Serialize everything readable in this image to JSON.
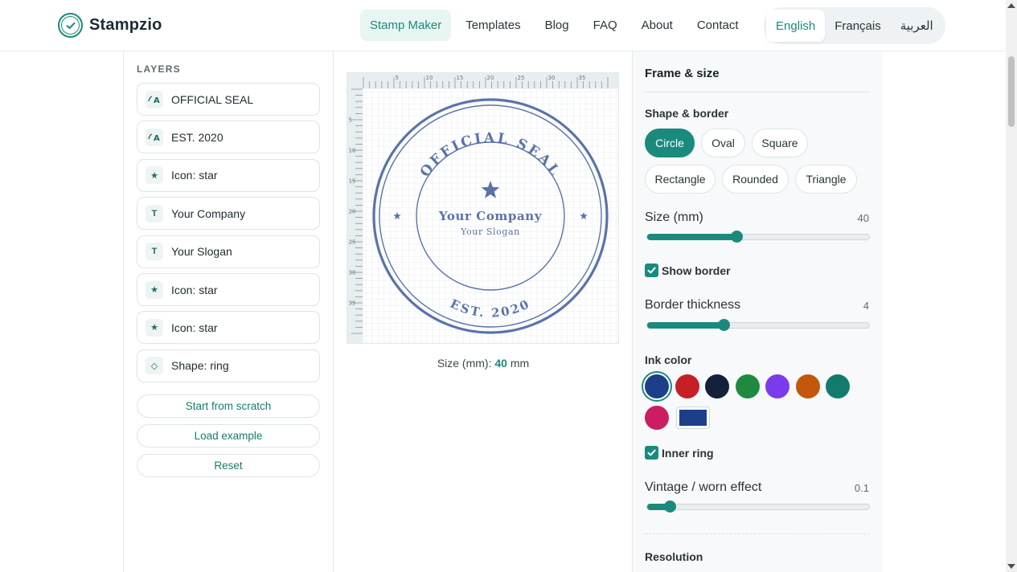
{
  "brand": {
    "name": "Stampzio"
  },
  "nav": {
    "items": [
      {
        "label": "Stamp Maker",
        "active": true
      },
      {
        "label": "Templates",
        "active": false
      },
      {
        "label": "Blog",
        "active": false
      },
      {
        "label": "FAQ",
        "active": false
      },
      {
        "label": "About",
        "active": false
      },
      {
        "label": "Contact",
        "active": false
      }
    ]
  },
  "languages": [
    {
      "label": "English",
      "active": true
    },
    {
      "label": "Français",
      "active": false
    },
    {
      "label": "العربية",
      "active": false
    }
  ],
  "layers": {
    "title": "LAYERS",
    "items": [
      {
        "label": "OFFICIAL SEAL",
        "icon": "curved-text-icon",
        "glyph": "A"
      },
      {
        "label": "EST. 2020",
        "icon": "curved-text-icon",
        "glyph": "A"
      },
      {
        "label": "Icon: star",
        "icon": "star-icon",
        "glyph": "★"
      },
      {
        "label": "Your Company",
        "icon": "text-icon",
        "glyph": "T"
      },
      {
        "label": "Your Slogan",
        "icon": "text-icon",
        "glyph": "T"
      },
      {
        "label": "Icon: star",
        "icon": "star-icon",
        "glyph": "★"
      },
      {
        "label": "Icon: star",
        "icon": "star-icon",
        "glyph": "★"
      },
      {
        "label": "Shape: ring",
        "icon": "ring-shape-icon",
        "glyph": "◇"
      }
    ],
    "actions": {
      "start": "Start from scratch",
      "load": "Load example",
      "reset": "Reset"
    }
  },
  "stamp": {
    "top_text": "OFFICIAL SEAL",
    "bottom_text": "EST. 2020",
    "company": "Your Company",
    "slogan": "Your Slogan",
    "ink_color": "#5a73aa",
    "ruler_labels": [
      "5",
      "10",
      "15",
      "20",
      "25",
      "30",
      "35"
    ]
  },
  "canvas": {
    "size_label": "Size (mm):",
    "size_value": "40",
    "size_unit": "mm"
  },
  "settings": {
    "title": "Frame & size",
    "shape_label": "Shape & border",
    "shapes": [
      {
        "label": "Circle",
        "active": true
      },
      {
        "label": "Oval",
        "active": false
      },
      {
        "label": "Square",
        "active": false
      },
      {
        "label": "Rectangle",
        "active": false
      },
      {
        "label": "Rounded",
        "active": false
      },
      {
        "label": "Triangle",
        "active": false
      }
    ],
    "size": {
      "label": "Size (mm)",
      "value": "40",
      "fraction": 0.4
    },
    "show_border": {
      "label": "Show border",
      "checked": true
    },
    "border_thickness": {
      "label": "Border thickness",
      "value": "4",
      "fraction": 0.34
    },
    "ink": {
      "label": "Ink color",
      "colors": [
        "#1d3f8a",
        "#c42026",
        "#15203a",
        "#1f8a3f",
        "#7c3aed",
        "#c2570c",
        "#137a6e",
        "#cc1d62"
      ],
      "selected": "#1d3f8a",
      "custom": "#1d3f8a"
    },
    "inner_ring": {
      "label": "Inner ring",
      "checked": true
    },
    "vintage": {
      "label": "Vintage / worn effect",
      "value": "0.1",
      "fraction": 0.1
    },
    "resolution_label": "Resolution"
  }
}
